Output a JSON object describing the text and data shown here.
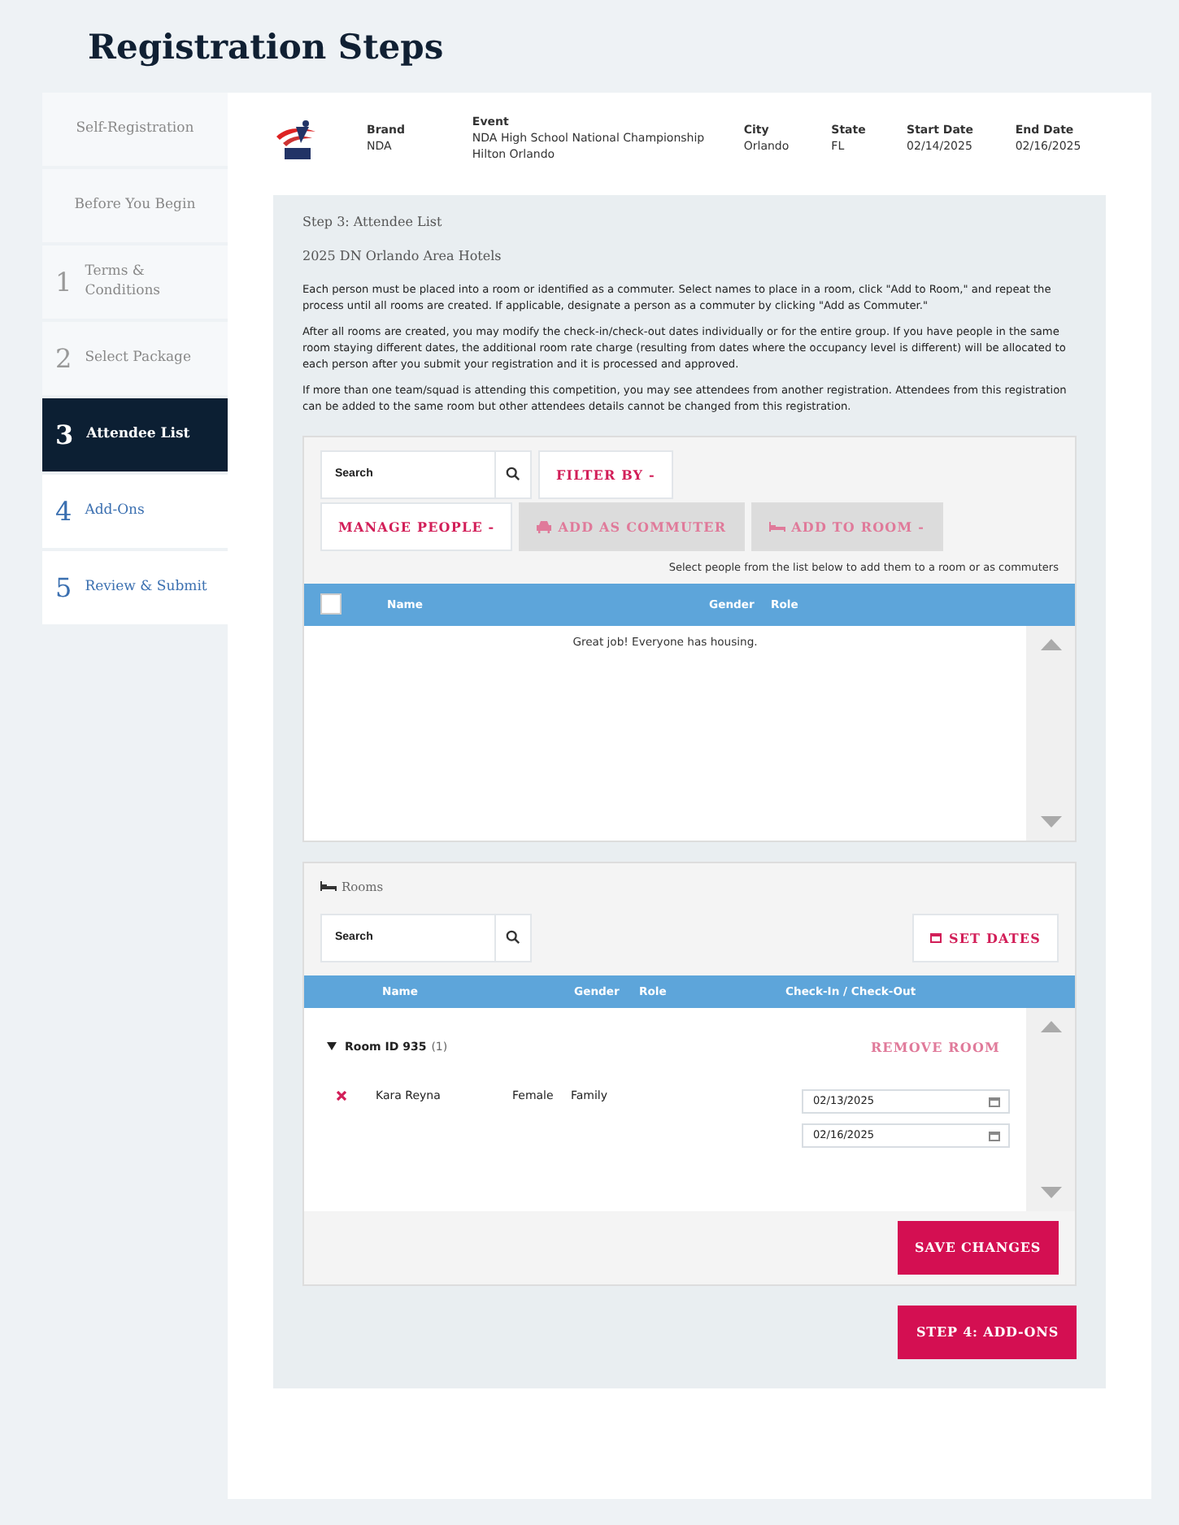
{
  "page_title": "Registration Steps",
  "sidebar": {
    "items": [
      {
        "label": "Self-Registration",
        "selected": false,
        "completed": true
      },
      {
        "label": "Before You Begin",
        "selected": false,
        "completed": true
      },
      {
        "number": "1",
        "label": "Terms & Conditions",
        "selected": false,
        "completed": true
      },
      {
        "number": "2",
        "label": "Select Package",
        "selected": false,
        "completed": true
      },
      {
        "number": "3",
        "label": "Attendee List",
        "selected": true,
        "completed": false
      },
      {
        "number": "4",
        "label": "Add-Ons",
        "selected": false,
        "completed": false
      },
      {
        "number": "5",
        "label": "Review & Submit",
        "selected": false,
        "completed": false
      }
    ]
  },
  "event_header": {
    "fields": [
      {
        "label": "Brand",
        "lines": [
          "NDA"
        ]
      },
      {
        "label": "Event",
        "lines": [
          "NDA High School National Championship",
          "Hilton Orlando"
        ]
      },
      {
        "label": "City",
        "lines": [
          "Orlando"
        ]
      },
      {
        "label": "State",
        "lines": [
          "FL"
        ]
      },
      {
        "label": "Start Date",
        "lines": [
          "02/14/2025"
        ]
      },
      {
        "label": "End Date",
        "lines": [
          "02/16/2025"
        ]
      }
    ]
  },
  "step_title": "Step 3: Attendee List",
  "hotel_title": "2025 DN Orlando Area Hotels",
  "instructions": [
    "Each person must be placed into a room or identified as a commuter. Select names to place in a room, click \"Add to Room,\" and repeat the process until all rooms are created. If applicable, designate a person as a commuter by clicking \"Add as Commuter.\"",
    "After all rooms are created, you may modify the check-in/check-out dates individually or for the entire group. If you have people in the same room staying different dates, the additional room rate charge (resulting from dates where the occupancy level is different) will be allocated to each person after you submit your registration and it is processed and approved.",
    "If more than one team/squad is attending this competition, you may see attendees from another registration. Attendees from this registration can be added to the same room but other attendees details cannot be changed from this registration."
  ],
  "attendees": {
    "search": {
      "placeholder": "Search"
    },
    "buttons": [
      {
        "label": "FILTER BY -",
        "disabled": false,
        "kind": "menu"
      },
      {
        "label": "MANAGE PEOPLE -",
        "disabled": false,
        "kind": "menu"
      },
      {
        "label": "ADD AS COMMUTER",
        "disabled": true,
        "kind": "commuter"
      },
      {
        "label": "ADD TO ROOM -",
        "disabled": true,
        "kind": "room"
      }
    ],
    "hint": "Select people from the list below to add them to a room or as commuters",
    "select_all_checked": false,
    "columns": [
      "Name",
      "Gender",
      "Role"
    ],
    "empty_message": "Great job! Everyone has housing."
  },
  "rooms": {
    "title": "Rooms",
    "search": {
      "placeholder": "Search"
    },
    "set_dates": "SET DATES",
    "columns": [
      "Name",
      "Gender",
      "Role",
      "Check-In / Check-Out"
    ],
    "groups": [
      {
        "title": "Room ID 935",
        "count": "(1)",
        "expanded": true,
        "remove": "REMOVE ROOM",
        "people": [
          {
            "name": "Kara Reyna",
            "gender": "Female",
            "role": "Family",
            "check_in": "02/13/2025",
            "check_out": "02/16/2025"
          }
        ]
      }
    ],
    "save": "SAVE CHANGES"
  },
  "next_button": "STEP 4: ADD-ONS"
}
